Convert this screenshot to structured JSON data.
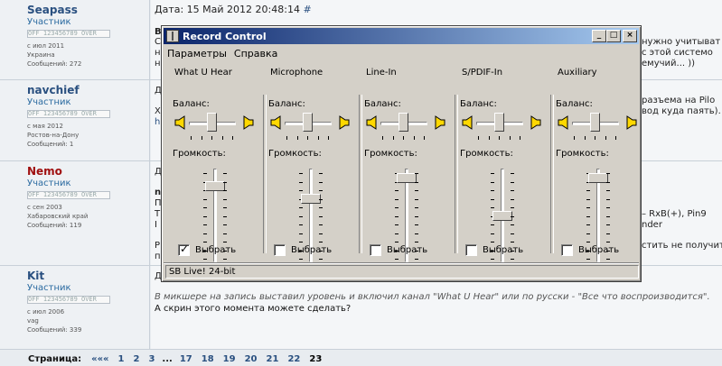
{
  "forum": {
    "posts": [
      {
        "user": "Seapass",
        "rank": "Участник",
        "stars": "OFF 123456789 OVER",
        "since": "с июл 2011",
        "location": "Украина",
        "messages": "Сообщений: 272",
        "date": "Дата: 15 Май 2012 20:48:14",
        "anchor": "#",
        "frags": [
          "B",
          "С",
          "н",
          "н",
          "нужно учитыват",
          "с этой системо",
          "емучий... ))"
        ]
      },
      {
        "user": "navchief",
        "rank": "Участник",
        "stars": "OFF 123456789 OVER",
        "since": "с мая 2012",
        "location": "Ростов-на-Дону",
        "messages": "Сообщений: 1",
        "frags": [
          "Д",
          "Х",
          "h",
          "разъема на Pilo",
          "вод куда паять)."
        ]
      },
      {
        "user": "Nemo",
        "rank": "Участник",
        "stars": "OFF 123456789 OVER",
        "since": "с сен 2003",
        "location": "Хабаровский край",
        "messages": "Сообщений: 119",
        "frags": [
          "Д",
          "n",
          "П",
          "Т",
          "I",
          "Р",
          "п",
          "– RxB(+), Pin9",
          "nder",
          "стить не получит"
        ]
      },
      {
        "user": "Kit",
        "rank": "Участник",
        "stars": "OFF 123456789 OVER",
        "since": "с июл 2006",
        "location": "vag",
        "messages": "Сообщений: 339",
        "frags": [
          "Д"
        ],
        "quote": "В микшере на запись выставил уровень и включил канал \"What U Hear\" или по русски - \"Все что воспроизводится\".",
        "text": "А скрин этого момента можете сделать?"
      }
    ],
    "pager": {
      "label": "Страница:",
      "first": "«««",
      "pages_a": [
        "1",
        "2",
        "3"
      ],
      "dots": "...",
      "pages_b": [
        "17",
        "18",
        "19",
        "20",
        "21",
        "22"
      ],
      "current": "23"
    }
  },
  "dialog": {
    "title": "Record Control",
    "buttons": {
      "minimize": "_",
      "maximize": "□",
      "close": "×"
    },
    "menu": [
      "Параметры",
      "Справка"
    ],
    "balance_label": "Баланс:",
    "volume_label": "Громкость:",
    "select_label": "Выбрать",
    "channels": [
      {
        "name": "What U Hear",
        "selected": true,
        "volume": 0.85
      },
      {
        "name": "Microphone",
        "selected": false,
        "volume": 0.7
      },
      {
        "name": "Line-In",
        "selected": false,
        "volume": 0.95
      },
      {
        "name": "S/PDIF-In",
        "selected": false,
        "volume": 0.5
      },
      {
        "name": "Auxiliary",
        "selected": false,
        "volume": 0.95
      }
    ],
    "status": "SB Live! 24-bit"
  }
}
